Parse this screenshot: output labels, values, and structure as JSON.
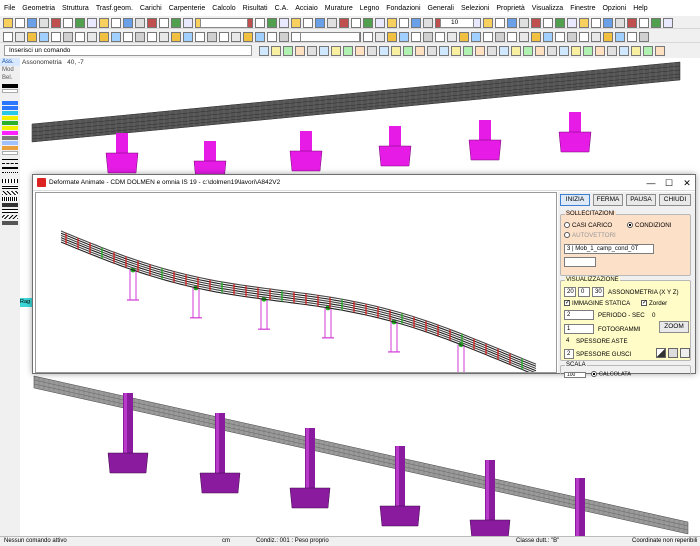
{
  "menu": [
    "File",
    "Geometria",
    "Struttura",
    "Trasf.geom.",
    "Carichi",
    "Carpenterie",
    "Calcolo",
    "Risultati",
    "C.A.",
    "Acciaio",
    "Murature",
    "Legno",
    "Fondazioni",
    "Generali",
    "Selezioni",
    "Proprietà",
    "Visualizza",
    "Finestre",
    "Opzioni",
    "Help"
  ],
  "toolbar": {
    "zoom_value": "10"
  },
  "command": {
    "placeholder": "Inserisci un comando"
  },
  "left_panel": {
    "tabs": [
      "Ass.",
      "Mod",
      "Bel."
    ]
  },
  "viewport": {
    "label": "Assonometria",
    "angles": "40, -7"
  },
  "side_tab": "Rag",
  "window": {
    "title": "Deformate Animate - CDM DOLMEN e omnia IS 19 - c:\\dolmen19\\lavori\\A842V2",
    "controls": [
      "—",
      "☐",
      "✕"
    ],
    "buttons": [
      "INIZIA",
      "FERMA",
      "PAUSA",
      "CHIUDI"
    ],
    "sollecitazioni": {
      "title": "SOLLECITAZIONI",
      "casi": "CASI CARICO",
      "condizioni": "CONDIZIONI",
      "autovettori": "AUTOVETTORI",
      "selected_case": "3 | Mob_1_camp_cond_0T"
    },
    "visualizzazione": {
      "title": "VISUALIZZAZIONE",
      "ax": "20",
      "ay": "0",
      "az": "30",
      "assonometria": "ASSONOMETRIA (X Y Z)",
      "immagine_statica": "IMMAGINE STATICA",
      "zorder": "Zorder",
      "periodo_value": "2",
      "periodo": "PERIODO - SEC",
      "periodo_sec": "0",
      "zoom": "ZOOM",
      "fotogrammi_value": "1",
      "fotogrammi": "FOTOGRAMMI",
      "aste_value": "4",
      "spessore_aste": "SPESSORE ASTE",
      "gusci_value": "2",
      "spessore_gusci": "SPESSORE GUSCI"
    },
    "scala": {
      "title": "SCALA",
      "value": "100",
      "calcolata": "CALCOLATA"
    }
  },
  "status": {
    "left": "Nessun comando attivo",
    "unit": "cm",
    "condiz": "Condiz.: 001 : Peso proprio",
    "classe": "Classe dutt.: \"B\"",
    "right": "Coordinate non reperibili"
  },
  "colors": {
    "deck": "#3a3a3a",
    "pier_top": "#e61ce6",
    "pier_bottom": "#8a1b9e",
    "deform_red": "#d81f1f",
    "deform_green": "#22b022",
    "pier_anim": "#d23ad6"
  }
}
